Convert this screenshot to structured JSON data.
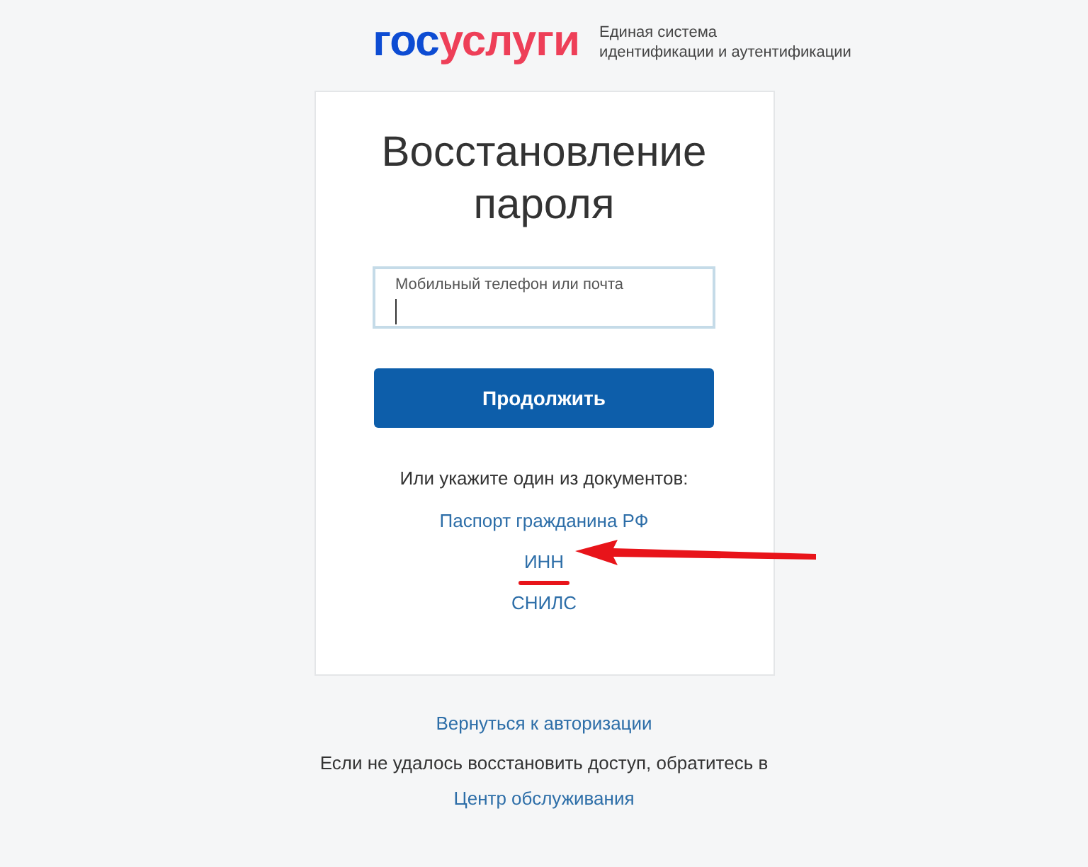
{
  "logo": {
    "parts": [
      {
        "text": "гос",
        "color": "#0d4cd3"
      },
      {
        "text": "услуги",
        "color": "#ee3f58"
      }
    ],
    "tagline": [
      "Единая система",
      "идентификации и аутентификации"
    ]
  },
  "card": {
    "title": "Восстановление пароля",
    "field": {
      "label": "Мобильный телефон или почта"
    },
    "button": "Продолжить",
    "alt_prompt": "Или укажите один из документов:",
    "documents": [
      {
        "label": "Паспорт гражданина РФ",
        "highlighted": false
      },
      {
        "label": "ИНН",
        "highlighted": true
      },
      {
        "label": "СНИЛС",
        "highlighted": false
      }
    ]
  },
  "back_link": "Вернуться к авторизации",
  "help_text": "Если не удалось восстановить доступ, обратитесь в",
  "help_link": "Центр обслуживания"
}
